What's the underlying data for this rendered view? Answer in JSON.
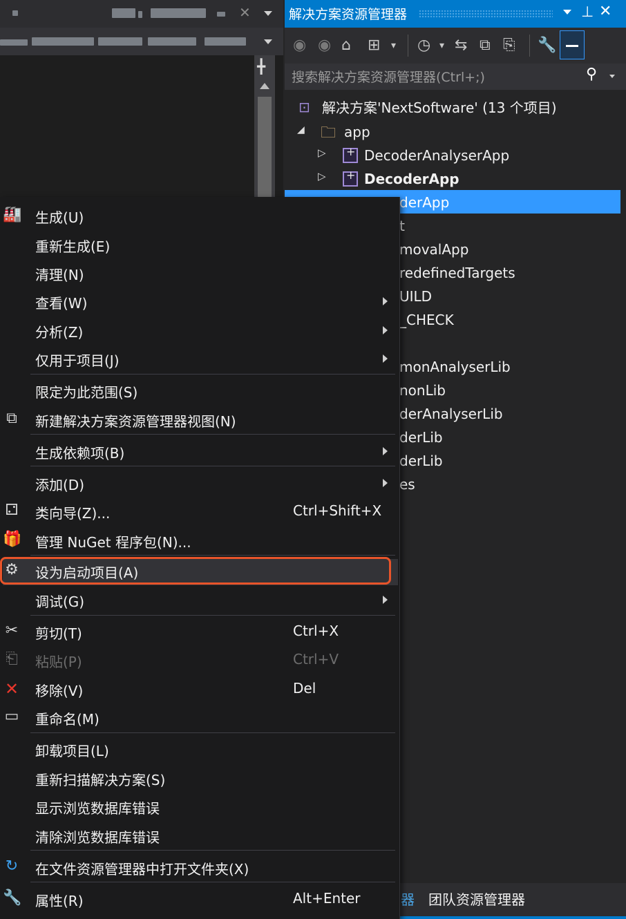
{
  "solution_explorer": {
    "title": "解决方案资源管理器",
    "pin_icon": "pin-icon",
    "search_placeholder": "搜索解决方案资源管理器(Ctrl+;)",
    "tree": {
      "solution": "解决方案'NextSoftware' (13 个项目)",
      "app_folder": "app",
      "project_1": "DecoderAnalyserApp",
      "project_2": "DecoderApp",
      "selected_partial": "derApp",
      "partial_rows": [
        "t",
        "movalApp",
        "redefinedTargets",
        "UILD",
        "_CHECK",
        "monAnalyserLib",
        "nonLib",
        "derAnalyserLib",
        "derLib",
        "derLib",
        "es"
      ]
    },
    "bottom_tabs": [
      "器",
      "团队资源管理器"
    ]
  },
  "context_menu": {
    "items": [
      {
        "label": "生成(U)",
        "icon": "build-icon"
      },
      {
        "label": "重新生成(E)"
      },
      {
        "label": "清理(N)"
      },
      {
        "label": "查看(W)",
        "submenu": true
      },
      {
        "label": "分析(Z)",
        "submenu": true
      },
      {
        "label": "仅用于项目(J)",
        "submenu": true
      },
      {
        "label": "限定为此范围(S)"
      },
      {
        "label": "新建解决方案资源管理器视图(N)",
        "icon": "new-view-icon"
      },
      {
        "label": "生成依赖项(B)",
        "submenu": true
      },
      {
        "label": "添加(D)",
        "submenu": true
      },
      {
        "label": "类向导(Z)...",
        "shortcut": "Ctrl+Shift+X",
        "icon": "class-wizard-icon"
      },
      {
        "label": "管理 NuGet 程序包(N)...",
        "icon": "nuget-icon"
      },
      {
        "label": "设为启动项目(A)",
        "icon": "gear-icon",
        "highlighted": true
      },
      {
        "label": "调试(G)",
        "submenu": true
      },
      {
        "label": "剪切(T)",
        "shortcut": "Ctrl+X",
        "icon": "scissors-icon"
      },
      {
        "label": "粘贴(P)",
        "shortcut": "Ctrl+V",
        "icon": "paste-icon",
        "disabled": true
      },
      {
        "label": "移除(V)",
        "shortcut": "Del",
        "icon": "remove-icon"
      },
      {
        "label": "重命名(M)",
        "icon": "rename-icon"
      },
      {
        "label": "卸载项目(L)"
      },
      {
        "label": "重新扫描解决方案(S)"
      },
      {
        "label": "显示浏览数据库错误"
      },
      {
        "label": "清除浏览数据库错误"
      },
      {
        "label": "在文件资源管理器中打开文件夹(X)",
        "icon": "open-folder-icon"
      },
      {
        "label": "属性(R)",
        "shortcut": "Alt+Enter",
        "icon": "wrench-icon"
      }
    ]
  },
  "colors": {
    "accent": "#007acc",
    "selection": "#3399ff",
    "highlight_border": "#e8542a",
    "menu_bg": "#1b1b1c",
    "remove_icon": "#e8372c"
  }
}
